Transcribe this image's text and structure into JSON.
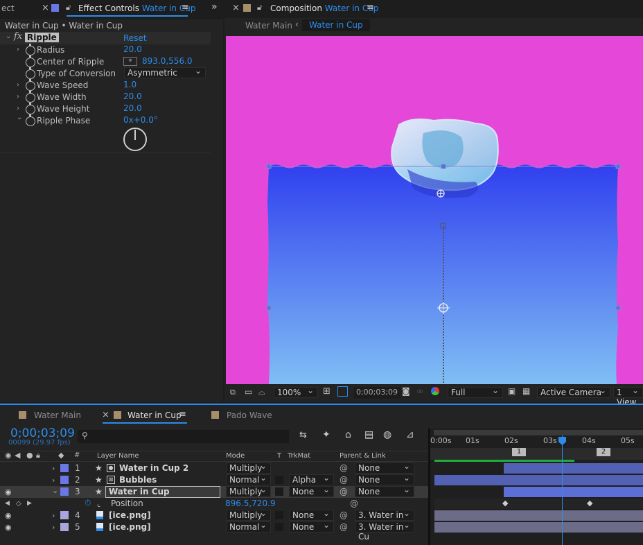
{
  "effect_panel": {
    "tab_partial": "ect",
    "tab_title": "Effect Controls",
    "tab_layer": "Water in Cup",
    "breadcrumb": "Water in Cup • Water in Cup",
    "effect_name": "Ripple",
    "reset_label": "Reset",
    "properties": [
      {
        "label": "Radius",
        "value": "20.0"
      },
      {
        "label": "Center of Ripple",
        "value": "893.0,556.0"
      },
      {
        "label": "Type of Conversion",
        "value": "Asymmetric"
      },
      {
        "label": "Wave Speed",
        "value": "1.0"
      },
      {
        "label": "Wave Width",
        "value": "20.0"
      },
      {
        "label": "Wave Height",
        "value": "20.0"
      },
      {
        "label": "Ripple Phase",
        "value": "0x+0.0°"
      }
    ]
  },
  "comp_panel": {
    "tab_title": "Composition",
    "tab_comp": "Water in Cup",
    "crumb_parent": "Water Main",
    "crumb_current": "Water in Cup",
    "zoom": "100%",
    "timecode": "0;00;03;09",
    "resolution": "Full",
    "camera": "Active Camera",
    "views": "1 View",
    "bg_color": "#e548d8",
    "water_top": "#3040ef",
    "water_bottom": "#80bef4"
  },
  "timeline": {
    "tabs": [
      "Water Main",
      "Water in Cup",
      "Pado Wave"
    ],
    "timecode": "0;00;03;09",
    "frames_info": "00099 (29.97 fps)",
    "search_placeholder": "",
    "col_layer_name": "Layer Name",
    "col_mode": "Mode",
    "col_t": "T",
    "col_trkmat": "TrkMat",
    "col_parent": "Parent & Link",
    "ruler": [
      "0:00s",
      "01s",
      "02s",
      "03s",
      "04s",
      "05s"
    ],
    "markers": [
      "1",
      "2"
    ],
    "layers": [
      {
        "num": "1",
        "name": "Water in Cup 2",
        "mode": "Multiply",
        "trkmat": "",
        "parent": "None",
        "color": "#6a78e6"
      },
      {
        "num": "2",
        "name": "Bubbles",
        "mode": "Normal",
        "trkmat": "Alpha",
        "parent": "None",
        "color": "#6a78e6"
      },
      {
        "num": "3",
        "name": "Water in Cup",
        "mode": "Multiply",
        "trkmat": "None",
        "parent": "None",
        "color": "#6a78e6"
      },
      {
        "num": "4",
        "name": "[ice.png]",
        "mode": "Multiply",
        "trkmat": "None",
        "parent": "3. Water in Cu",
        "color": "#a9a6dd"
      },
      {
        "num": "5",
        "name": "[ice.png]",
        "mode": "Normal",
        "trkmat": "None",
        "parent": "3. Water in Cu",
        "color": "#a9a6dd"
      }
    ],
    "position_label": "Position",
    "position_value": "896.5,720.9"
  }
}
